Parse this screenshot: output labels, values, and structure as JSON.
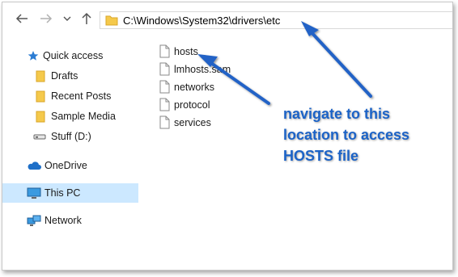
{
  "navigation": {
    "back_icon": "back-arrow-icon",
    "forward_icon": "forward-arrow-icon",
    "up_icon": "up-arrow-icon",
    "address_path": "C:\\Windows\\System32\\drivers\\etc"
  },
  "sidebar": {
    "items": [
      {
        "label": "Quick access",
        "icon": "star-icon"
      },
      {
        "label": "Drafts",
        "icon": "folder-icon"
      },
      {
        "label": "Recent Posts",
        "icon": "folder-icon"
      },
      {
        "label": "Sample Media",
        "icon": "folder-icon"
      },
      {
        "label": "Stuff (D:)",
        "icon": "drive-icon"
      },
      {
        "label": "OneDrive",
        "icon": "cloud-icon"
      },
      {
        "label": "This PC",
        "icon": "computer-icon"
      },
      {
        "label": "Network",
        "icon": "network-icon"
      }
    ]
  },
  "files": [
    {
      "name": "hosts"
    },
    {
      "name": "lmhosts.sam"
    },
    {
      "name": "networks"
    },
    {
      "name": "protocol"
    },
    {
      "name": "services"
    }
  ],
  "annotation": {
    "line1": "navigate to this",
    "line2": "location to access",
    "line3": "HOSTS file"
  },
  "colors": {
    "selection": "#cce8ff",
    "folder": "#f5c94b",
    "annotation": "#1c63c7"
  }
}
